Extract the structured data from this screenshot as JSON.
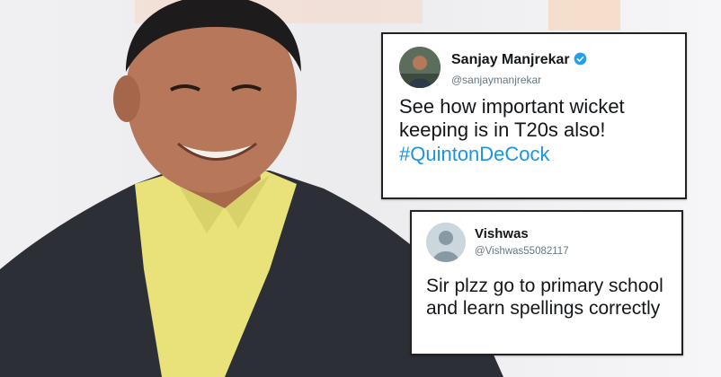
{
  "tweets": [
    {
      "name": "Sanjay Manjrekar",
      "handle": "@sanjaymanjrekar",
      "verified": true,
      "text": "See how important wicket keeping is in T20s also!",
      "hashtag": "#QuintonDeCock"
    },
    {
      "name": "Vishwas",
      "handle": "@Vishwas55082117",
      "verified": false,
      "text": "Sir plzz go to primary school and learn spellings correctly"
    }
  ],
  "colors": {
    "link": "#1b95e0",
    "verified": "#1da1f2",
    "handle": "#657786"
  },
  "icons": [
    "verified-badge-icon",
    "default-avatar-icon"
  ]
}
